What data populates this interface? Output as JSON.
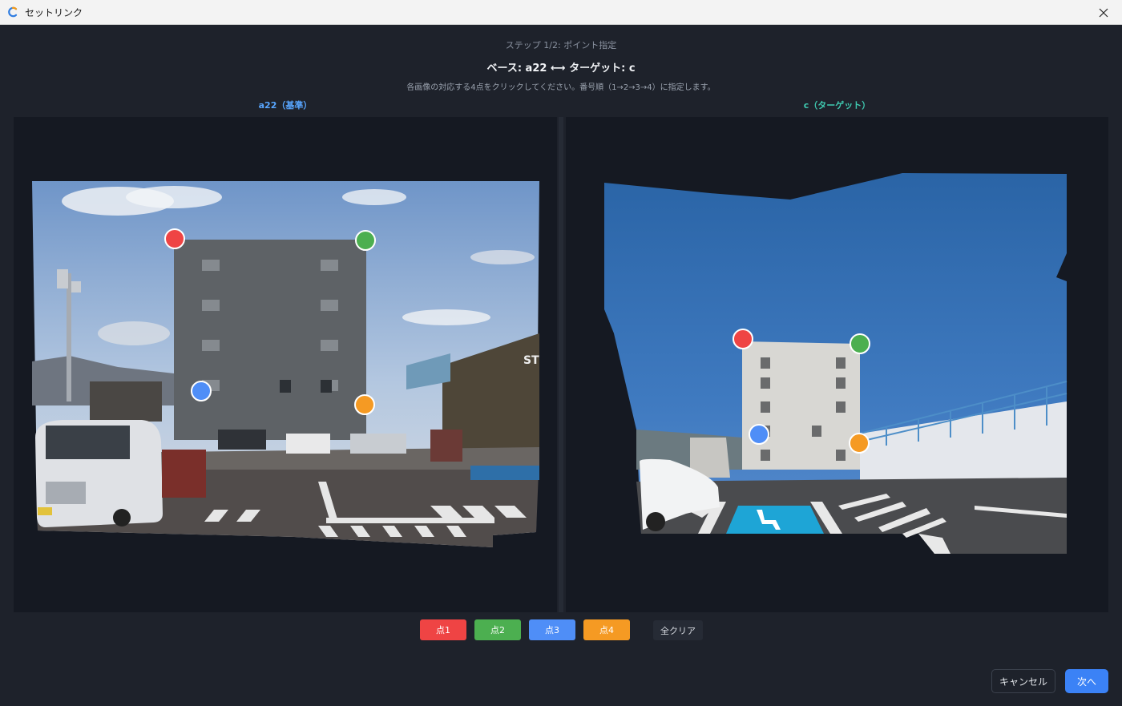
{
  "window": {
    "title": "セットリンク"
  },
  "header": {
    "step": "ステップ 1/2: ポイント指定",
    "pair": "ベース: a22 ⟷ ターゲット: c",
    "instruction": "各画像の対応する4点をクリックしてください。番号順（1→2→3→4）に指定します。"
  },
  "panes": {
    "left_label": "a22（基準）",
    "right_label": "c（ターゲット）",
    "left_sign": "ST"
  },
  "points": [
    {
      "label": "点1",
      "color": "#ef4444"
    },
    {
      "label": "点2",
      "color": "#4caf50"
    },
    {
      "label": "点3",
      "color": "#4f8ef7"
    },
    {
      "label": "点4",
      "color": "#f59a23"
    }
  ],
  "actions": {
    "clear": "全クリア",
    "cancel": "キャンセル",
    "next": "次へ"
  }
}
